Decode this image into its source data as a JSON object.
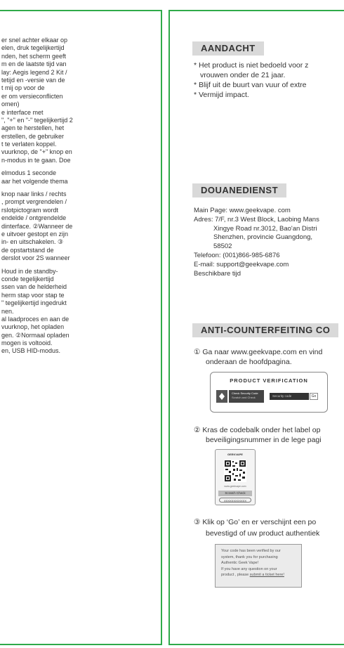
{
  "left_page": {
    "lines": [
      "er snel achter elkaar op",
      "elen, druk tegelijkertijd",
      "nden, het scherm geeft",
      "m en de laatste tijd van",
      "lay: Aegis legend 2 Kit /",
      "tetijd en -versie van de",
      "t mij op voor de",
      "er om versieconflicten",
      "omen)",
      "e interface met",
      "\", \"+\" en \"-\" tegelijkertijd 2",
      "agen te herstellen, het",
      "erstellen, de gebruiker",
      "t te verlaten koppel.",
      "vuurknop, de \"+\" knop en",
      "n-modus in te gaan. Doe",
      "",
      "elmodus 1 seconde",
      "aar het volgende thema",
      "",
      "knop naar links / rechts",
      ", prompt vergrendelen /",
      "rslotpictogram wordt",
      "endelde / ontgrendelde",
      "dinterface. ②Wanneer de",
      "e uitvoer gestopt en zijn",
      "in- en uitschakelen. ③",
      "de opstartstand de",
      "derslot voor 2S wanneer",
      "",
      "Houd in de standby-",
      "conde tegelijkertijd",
      "ssen van de helderheid",
      "herm stap voor stap te",
      "\" tegelijkertijd ingedrukt",
      "nen.",
      "al laadproces en aan de",
      " vuurknop, het opladen",
      "gen. ②Normaal opladen",
      "mogen is voltooid.",
      "en, USB HID-modus."
    ]
  },
  "aandacht": {
    "header": "AANDACHT",
    "items": [
      "* Het product is niet bedoeld voor z",
      "vrouwen onder de 21 jaar.",
      "* Blijf uit de buurt van vuur of extre",
      "* Vermijd impact."
    ]
  },
  "douane": {
    "header": "DOUANEDIENST",
    "main_page": "Main Page: www.geekvape. com",
    "adres": "Adres: 7/F, nr.3 West Block, Laobing Mans",
    "adres_2": "Xingye Road nr.3012, Bao'an Distri",
    "adres_3": "Shenzhen, provincie Guangdong,",
    "adres_4": "58502",
    "telefoon": "Telefoon: (001)866-985-6876",
    "email": "E-mail: support@geekvape.com",
    "tijd": "Beschikbare tijd"
  },
  "anti": {
    "header": "ANTI-COUNTERFEITING CO",
    "step1_a": "① Ga naar www.geekvape.com en vind",
    "step1_b": "onderaan de hoofdpagina.",
    "pv_title": "PRODUCT VERIFICATION",
    "pv_check": "Check Security Code",
    "pv_scratch": "Scratch and Check",
    "pv_placeholder": "Security code",
    "pv_go": "Go",
    "step2_a": "② Kras de codebalk onder het label op",
    "step2_b": "beveiligingsnummer in de lege pagi",
    "label_brand": "GEEKVAPE",
    "label_url": "www.geekvape.com",
    "label_scratch": "Scratch Check",
    "label_code": "XXXXXXXXXXXX",
    "step3_a": "③ Klik op ‘Go’ en er verschijnt een po",
    "step3_b": "bevestigd of uw product authentiek",
    "msg_1": "Your code has been verified by our",
    "msg_2": "system, thank you for purchasing",
    "msg_3": "Authentic Geek Vape!",
    "msg_4": "If you have any question on your",
    "msg_5": "product , please",
    "msg_link": "submit a ticket here!"
  },
  "colors": {
    "border": "#2faa4a",
    "header_bg": "#d9d9d9",
    "text": "#333333"
  }
}
